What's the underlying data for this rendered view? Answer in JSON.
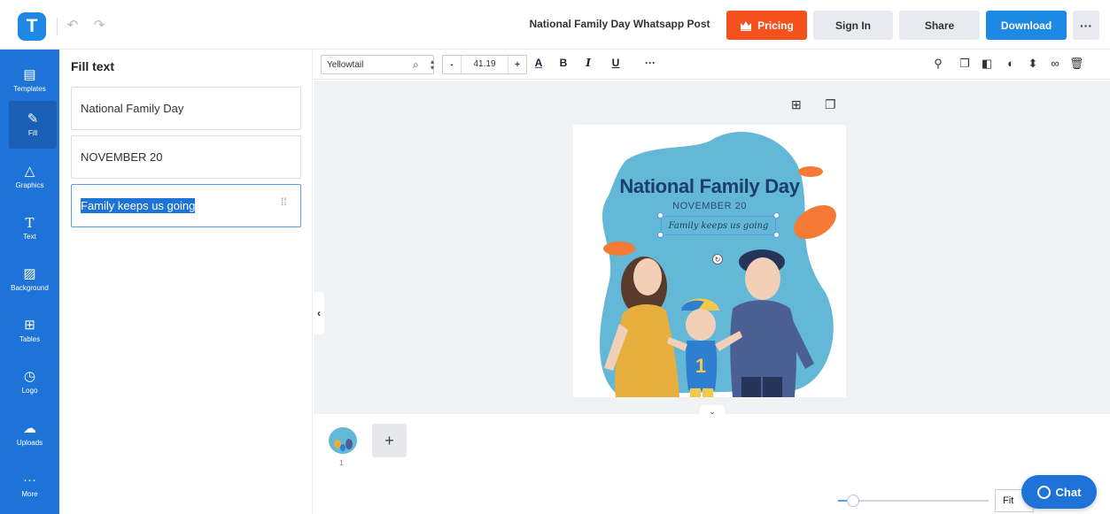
{
  "header": {
    "logo_letter": "T",
    "doc_title": "National Family Day Whatsapp Post",
    "pricing_label": "Pricing",
    "signin_label": "Sign In",
    "share_label": "Share",
    "download_label": "Download",
    "more_label": "···"
  },
  "colors": {
    "brand_blue": "#1e88e5",
    "rail_blue": "#1e73d8",
    "pricing_orange": "#f4511e",
    "selection_outline": "#5b9be8"
  },
  "rail": {
    "items": [
      {
        "label": "Templates",
        "icon": "templates-icon"
      },
      {
        "label": "Fill",
        "icon": "pencil-icon"
      },
      {
        "label": "Graphics",
        "icon": "shapes-icon"
      },
      {
        "label": "Text",
        "icon": "text-icon"
      },
      {
        "label": "Background",
        "icon": "background-icon"
      },
      {
        "label": "Tables",
        "icon": "table-icon"
      },
      {
        "label": "Logo",
        "icon": "logo-icon"
      },
      {
        "label": "Uploads",
        "icon": "cloud-upload-icon"
      },
      {
        "label": "More",
        "icon": "more-icon"
      }
    ]
  },
  "panel": {
    "title": "Fill text",
    "fields": [
      {
        "value": "National Family Day"
      },
      {
        "value": "NOVEMBER 20"
      },
      {
        "value": "Family keeps us going"
      }
    ]
  },
  "toolbar": {
    "font_name": "Yellowtail",
    "font_size": "41.19",
    "minus": "-",
    "plus": "+",
    "color_btn": "A",
    "bold": "B",
    "italic": "I",
    "underline": "U",
    "more": "···"
  },
  "design": {
    "title": "National Family Day",
    "date": "NOVEMBER 20",
    "tagline": "Family keeps us going"
  },
  "pages": {
    "thumb_number": "1",
    "add_label": "+"
  },
  "footer": {
    "zoom_label": "Fit",
    "zoom_level": 0.1,
    "chat_label": "Chat"
  }
}
